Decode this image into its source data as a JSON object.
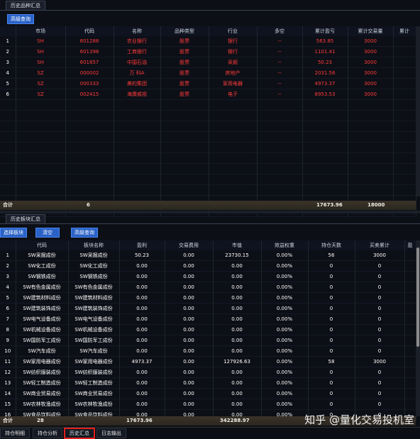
{
  "top_panel": {
    "tab_label": "历史品种汇总",
    "advanced_query_button": "高级查询",
    "columns": [
      "",
      "市场",
      "代码",
      "名称",
      "品种类型",
      "行业",
      "多空",
      "累计盈亏",
      "累计交易量",
      "累计"
    ],
    "rows": [
      {
        "idx": "1",
        "market": "SH",
        "code": "601288",
        "name": "农业银行",
        "type": "股票",
        "industry": "银行",
        "dir": "--",
        "pnl": "563.85",
        "vol": "3000"
      },
      {
        "idx": "2",
        "market": "SH",
        "code": "601398",
        "name": "工商银行",
        "type": "股票",
        "industry": "银行",
        "dir": "--",
        "pnl": "1101.41",
        "vol": "3000"
      },
      {
        "idx": "3",
        "market": "SH",
        "code": "601857",
        "name": "中国石油",
        "type": "股票",
        "industry": "采掘",
        "dir": "--",
        "pnl": "50.23",
        "vol": "3000"
      },
      {
        "idx": "4",
        "market": "SZ",
        "code": "000002",
        "name": "万 科A",
        "type": "股票",
        "industry": "房地产",
        "dir": "--",
        "pnl": "2031.56",
        "vol": "3000"
      },
      {
        "idx": "5",
        "market": "SZ",
        "code": "000333",
        "name": "美的集团",
        "type": "股票",
        "industry": "家用电器",
        "dir": "--",
        "pnl": "4973.37",
        "vol": "3000"
      },
      {
        "idx": "6",
        "market": "SZ",
        "code": "002415",
        "name": "海康威视",
        "type": "股票",
        "industry": "电子",
        "dir": "--",
        "pnl": "8953.53",
        "vol": "3000"
      }
    ],
    "summary": {
      "label": "合计",
      "count": "6",
      "pnl": "17673.96",
      "vol": "18000"
    }
  },
  "bottom_panel": {
    "tab_label": "历史板块汇总",
    "select_sector_button": "选择板块",
    "clear_button": "清空",
    "advanced_query_button": "高级查询",
    "columns": [
      "",
      "代码",
      "板块名称",
      "盈利",
      "交易费用",
      "市值",
      "效益权重",
      "持仓天数",
      "买卖累计",
      "盈"
    ],
    "rows": [
      {
        "idx": "1",
        "code": "SW采掘成份",
        "name": "SW采掘成份",
        "profit": "50.23",
        "fee": "0.00",
        "mv": "23730.15",
        "w": "0.00%",
        "days": "56",
        "acc": "3000"
      },
      {
        "idx": "2",
        "code": "SW化工成份",
        "name": "SW化工成份",
        "profit": "0.00",
        "fee": "0.00",
        "mv": "0.00",
        "w": "0.00%",
        "days": "0",
        "acc": "0"
      },
      {
        "idx": "3",
        "code": "SW钢铁成份",
        "name": "SW钢铁成份",
        "profit": "0.00",
        "fee": "0.00",
        "mv": "0.00",
        "w": "0.00%",
        "days": "0",
        "acc": "0"
      },
      {
        "idx": "4",
        "code": "SW有色金属成份",
        "name": "SW有色金属成份",
        "profit": "0.00",
        "fee": "0.00",
        "mv": "0.00",
        "w": "0.00%",
        "days": "0",
        "acc": "0"
      },
      {
        "idx": "5",
        "code": "SW建筑材料成份",
        "name": "SW建筑材料成份",
        "profit": "0.00",
        "fee": "0.00",
        "mv": "0.00",
        "w": "0.00%",
        "days": "0",
        "acc": "0"
      },
      {
        "idx": "6",
        "code": "SW建筑装饰成份",
        "name": "SW建筑装饰成份",
        "profit": "0.00",
        "fee": "0.00",
        "mv": "0.00",
        "w": "0.00%",
        "days": "0",
        "acc": "0"
      },
      {
        "idx": "7",
        "code": "SW电气设备成份",
        "name": "SW电气设备成份",
        "profit": "0.00",
        "fee": "0.00",
        "mv": "0.00",
        "w": "0.00%",
        "days": "0",
        "acc": "0"
      },
      {
        "idx": "8",
        "code": "SW机械设备成份",
        "name": "SW机械设备成份",
        "profit": "0.00",
        "fee": "0.00",
        "mv": "0.00",
        "w": "0.00%",
        "days": "0",
        "acc": "0"
      },
      {
        "idx": "9",
        "code": "SW国防军工成份",
        "name": "SW国防军工成份",
        "profit": "0.00",
        "fee": "0.00",
        "mv": "0.00",
        "w": "0.00%",
        "days": "0",
        "acc": "0"
      },
      {
        "idx": "10",
        "code": "SW汽车成份",
        "name": "SW汽车成份",
        "profit": "0.00",
        "fee": "0.00",
        "mv": "0.00",
        "w": "0.00%",
        "days": "0",
        "acc": "0"
      },
      {
        "idx": "11",
        "code": "SW家用电器成份",
        "name": "SW家用电器成份",
        "profit": "4973.37",
        "fee": "0.00",
        "mv": "127926.63",
        "w": "0.00%",
        "days": "58",
        "acc": "3000"
      },
      {
        "idx": "12",
        "code": "SW纺织服装成份",
        "name": "SW纺织服装成份",
        "profit": "0.00",
        "fee": "0.00",
        "mv": "0.00",
        "w": "0.00%",
        "days": "0",
        "acc": "0"
      },
      {
        "idx": "13",
        "code": "SW轻工制造成份",
        "name": "SW轻工制造成份",
        "profit": "0.00",
        "fee": "0.00",
        "mv": "0.00",
        "w": "0.00%",
        "days": "0",
        "acc": "0"
      },
      {
        "idx": "14",
        "code": "SW商业贸易成份",
        "name": "SW商业贸易成份",
        "profit": "0.00",
        "fee": "0.00",
        "mv": "0.00",
        "w": "0.00%",
        "days": "0",
        "acc": "0"
      },
      {
        "idx": "15",
        "code": "SW农林牧渔成份",
        "name": "SW农林牧渔成份",
        "profit": "0.00",
        "fee": "0.00",
        "mv": "0.00",
        "w": "0.00%",
        "days": "0",
        "acc": "0"
      },
      {
        "idx": "16",
        "code": "SW食品饮料成份",
        "name": "SW食品饮料成份",
        "profit": "0.00",
        "fee": "0.00",
        "mv": "0.00",
        "w": "0.00%",
        "days": "0",
        "acc": "0"
      }
    ],
    "summary": {
      "label": "合计",
      "count": "28",
      "profit": "17673.96",
      "mv": "342288.97"
    }
  },
  "bottom_tabs": [
    "持仓明细",
    "持仓分析",
    "历史汇总",
    "日志输出"
  ],
  "active_bottom_tab": "历史汇总",
  "watermark": "知乎 @量化交易投机室",
  "colors": {
    "background": "#0c0f16",
    "accent": "#2a62c7",
    "red_text": "#ff3b3b",
    "active_tab_border": "#e0211e"
  }
}
